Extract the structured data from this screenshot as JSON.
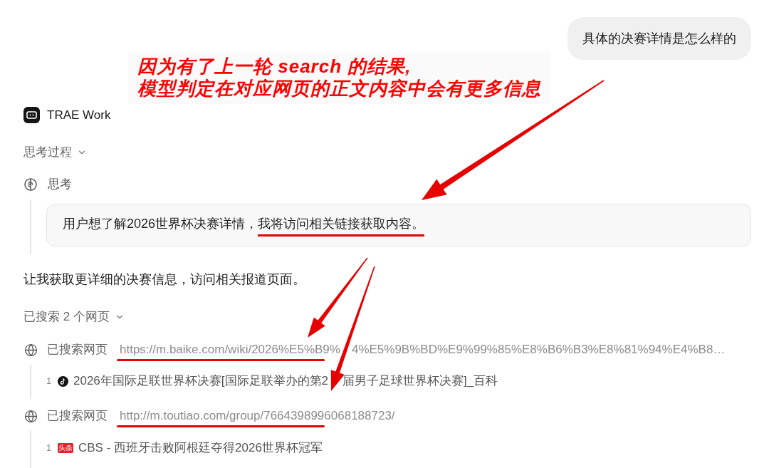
{
  "user_message": {
    "text": "具体的决赛详情是怎么样的"
  },
  "annotation": {
    "lines": [
      "因为有了上一轮 search 的结果,",
      "模型判定在对应网页的正文内容中会有更多信息"
    ]
  },
  "assistant": {
    "name": "TRAE Work"
  },
  "thinking_process": {
    "label": "思考过程",
    "expanded": true,
    "steps": [
      {
        "label": "思考",
        "segments": [
          {
            "text": "用户想了解2026世界杯决赛详情，",
            "marked": false
          },
          {
            "text": "我将访问相关链接获取内容。",
            "marked": true
          }
        ]
      }
    ]
  },
  "reply": "让我获取更详细的决赛信息，访问相关报道页面。",
  "search_summary": {
    "label": "已搜索 2 个网页",
    "expanded": true,
    "searches": [
      {
        "label": "已搜索网页",
        "url_parts": [
          "https://m.baike.com/wiki/2026%E5%B9%",
          "4%E5%9B%BD%E9%99%85%E8%B6%B3%E8%81%94%E4%B8…"
        ],
        "url_marked": true,
        "results": [
          {
            "index": "1",
            "kind": "note",
            "title_parts": [
              "2026年国际足联世界杯决赛[国际足联举办的第2",
              "届男子足球世界杯决赛]_百科"
            ]
          }
        ]
      },
      {
        "label": "已搜索网页",
        "url_parts": [
          "http://m.toutiao.com/group/7664398996068188723/"
        ],
        "url_marked": true,
        "results": [
          {
            "index": "1",
            "kind": "tag",
            "source_tag": "头条",
            "title_parts": [
              "CBS - 西班牙击败阿根廷夺得2026世界杯冠军"
            ]
          }
        ]
      }
    ]
  }
}
